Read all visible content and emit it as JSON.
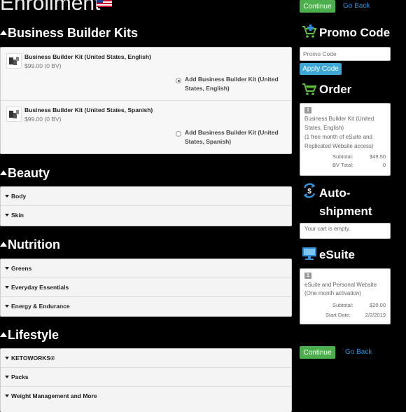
{
  "header": {
    "title": "Enrollment",
    "continue_label": "Continue",
    "go_back_label": "Go Back"
  },
  "kits": {
    "title": "Business Builder Kits",
    "items": [
      {
        "name": "Business Builder Kit (United States, English)",
        "price": "$99.00 (0 BV)",
        "option_label": "Add Business Builder Kit (United States, English)",
        "selected": true
      },
      {
        "name": "Business Builder Kit (United States, Spanish)",
        "price": "$99.00 (0 BV)",
        "option_label": "Add Business Builder Kit (United States, Spanish)",
        "selected": false
      }
    ]
  },
  "beauty": {
    "title": "Beauty",
    "items": [
      "Body",
      "Skin"
    ]
  },
  "nutrition": {
    "title": "Nutrition",
    "items": [
      "Greens",
      "Everyday Essentials",
      "Energy & Endurance"
    ]
  },
  "lifestyle": {
    "title": "Lifestyle",
    "items": [
      "KETOWORKS®",
      "Packs",
      "Weight Management and More"
    ]
  },
  "promo": {
    "title": "Promo Code",
    "placeholder": "Promo Code",
    "apply_label": "Apply Code"
  },
  "order": {
    "title": "Order",
    "qty": "1",
    "item_text": "Business Builder Kit (United States, English)",
    "item_note": "(1 free month of eSuite and Replicated Website access)",
    "subtotal_label": "Subtotal:",
    "subtotal_value": "$49.50",
    "bv_label": "BV Total:",
    "bv_value": "0"
  },
  "autoship": {
    "title_line1": "Auto-",
    "title_line2": "shipment",
    "empty_text": "Your cart is empty."
  },
  "esuite": {
    "title": "eSuite",
    "qty": "1",
    "item_text": "eSuite and Personal Website (One month activation)",
    "subtotal_label": "Subtotal:",
    "subtotal_value": "$20.00",
    "start_label": "Start Date:",
    "start_value": "2/2/2019"
  },
  "footer": {
    "continue_label": "Continue",
    "go_back_label": "Go Back"
  },
  "icons": {
    "flag": "us-flag-icon",
    "promo": "cart-plus-icon",
    "order": "cart-icon",
    "autoship": "recurring-dollar-icon",
    "esuite": "monitor-icon"
  },
  "colors": {
    "background": "#000000",
    "continue_green": "#4cae4c",
    "apply_blue": "#3fa7d6",
    "link_blue": "#2a8fd8",
    "icon_green": "#5cbf3a",
    "icon_blue": "#2f8fd8"
  }
}
